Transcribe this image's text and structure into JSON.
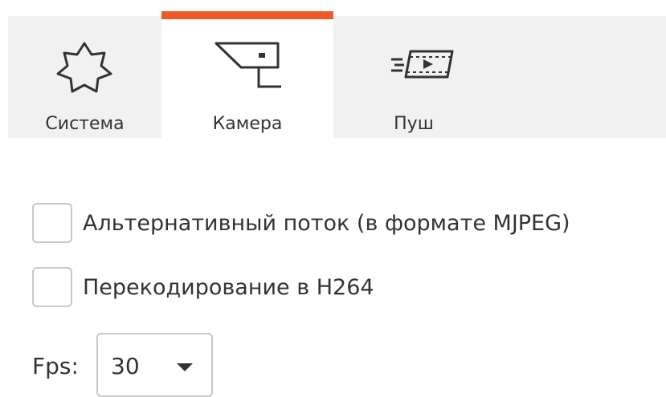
{
  "tabs": [
    {
      "label": "Система",
      "icon": "gear-icon",
      "active": false
    },
    {
      "label": "Камера",
      "icon": "camera-icon",
      "active": true
    },
    {
      "label": "Пуш",
      "icon": "push-video-icon",
      "active": false
    }
  ],
  "options": [
    {
      "label": "Альтернативный поток (в формате MJPEG)",
      "checked": false
    },
    {
      "label": "Перекодирование в H264",
      "checked": false
    }
  ],
  "fps": {
    "label": "Fps:",
    "value": "30"
  },
  "colors": {
    "accent": "#f05a28",
    "tabbar_bg": "#f1f1f1",
    "text": "#333333",
    "border": "#c8c8c8"
  }
}
